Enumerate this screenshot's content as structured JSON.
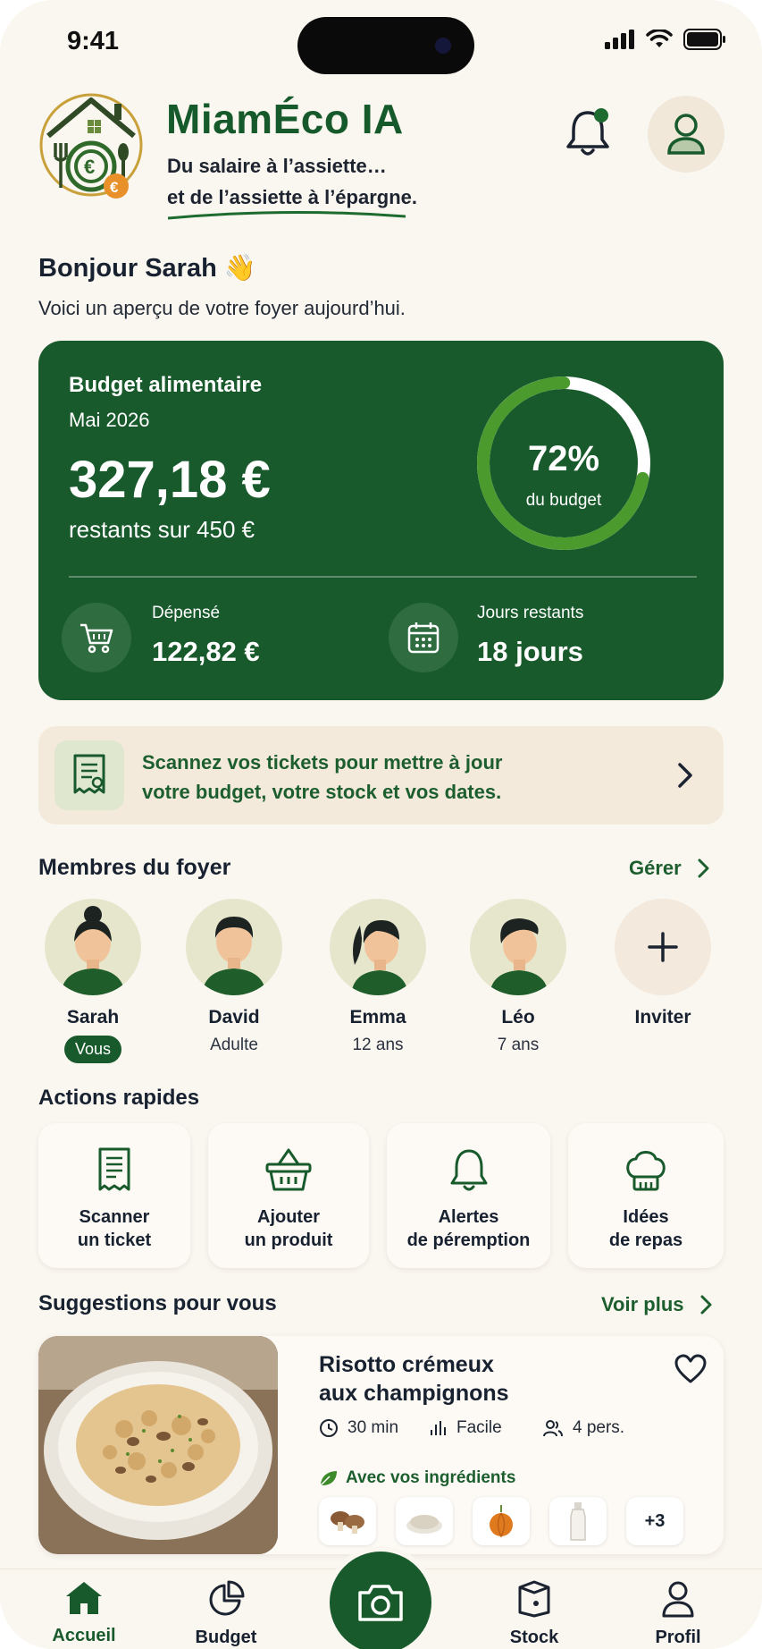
{
  "status_bar": {
    "time": "9:41"
  },
  "header": {
    "app_name": "MiamÉco IA",
    "tagline_line1": "Du salaire à l’assiette…",
    "tagline_line2": "et de l’assiette à l’épargne."
  },
  "greeting": {
    "title": "Bonjour Sarah 👋",
    "subtitle": "Voici un aperçu de votre foyer aujourd’hui."
  },
  "budget": {
    "title": "Budget alimentaire",
    "month": "Mai 2026",
    "remaining": "327,18 €",
    "remaining_sub": "restants sur 450 €",
    "percent_label": "72%",
    "percent_value": 0.72,
    "percent_caption": "du budget",
    "spent_label": "Dépensé",
    "spent_value": "122,82 €",
    "days_label": "Jours restants",
    "days_value": "18 jours"
  },
  "scan_banner": {
    "line1": "Scannez vos tickets pour mettre à jour",
    "line2": "votre budget, votre stock et vos dates."
  },
  "members": {
    "title": "Membres du foyer",
    "manage_label": "Gérer",
    "items": [
      {
        "name": "Sarah",
        "role": "Vous"
      },
      {
        "name": "David",
        "role": "Adulte"
      },
      {
        "name": "Emma",
        "role": "12 ans"
      },
      {
        "name": "Léo",
        "role": "7 ans"
      }
    ],
    "invite_label": "Inviter"
  },
  "actions": {
    "title": "Actions rapides",
    "items": [
      {
        "label": "Scanner\nun ticket"
      },
      {
        "label": "Ajouter\nun produit"
      },
      {
        "label": "Alertes\nde péremption"
      },
      {
        "label": "Idées\nde repas"
      }
    ]
  },
  "suggestions": {
    "title": "Suggestions pour vous",
    "more_label": "Voir plus",
    "recipe": {
      "title": "Risotto crémeux\naux champignons",
      "time": "30 min",
      "difficulty": "Facile",
      "servings": "4 pers.",
      "ingredients_label": "Avec vos ingrédients",
      "more_count": "+3"
    }
  },
  "nav": {
    "home": "Accueil",
    "budget": "Budget",
    "stock": "Stock",
    "profile": "Profil"
  },
  "colors": {
    "primary": "#185a2c",
    "background": "#faf6f0",
    "ring_track": "#ffffff",
    "ring_fill": "#4a9a2e"
  }
}
